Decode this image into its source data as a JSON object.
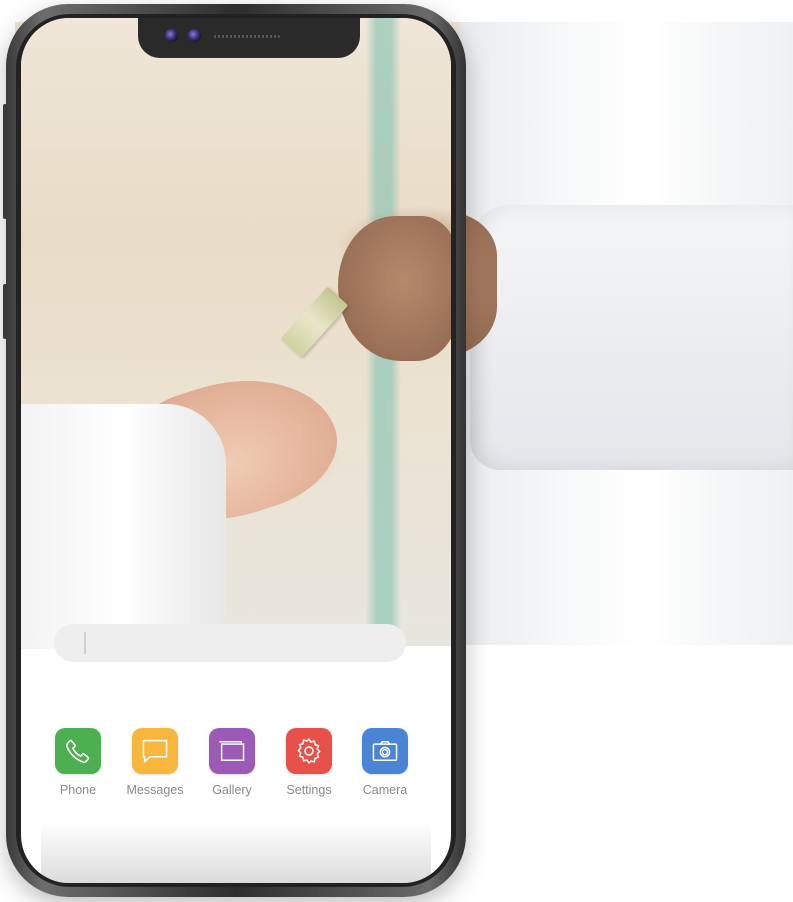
{
  "wallpaper": {
    "description_icon": "photo-icon"
  },
  "search": {
    "value": ""
  },
  "dock": {
    "apps": [
      {
        "label": "Phone",
        "icon": "phone-icon",
        "color": "#4caf50"
      },
      {
        "label": "Messages",
        "icon": "message-icon",
        "color": "#f6b73c"
      },
      {
        "label": "Gallery",
        "icon": "gallery-icon",
        "color": "#9c59b6"
      },
      {
        "label": "Settings",
        "icon": "gear-icon",
        "color": "#e8504a"
      },
      {
        "label": "Camera",
        "icon": "camera-icon",
        "color": "#4a84d4"
      }
    ]
  },
  "colors": {
    "phone_frame": "#3a3a3a",
    "screen_bg": "#ffffff",
    "label_text": "#8a8a8a"
  }
}
